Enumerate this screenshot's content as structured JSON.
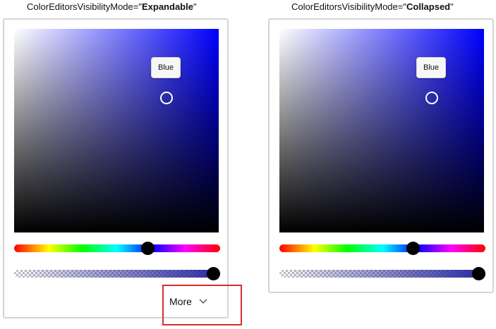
{
  "left_panel": {
    "caption_prefix": "ColorEditorsVisibilityMode=\"",
    "caption_value": "Expandable",
    "caption_suffix": "\"",
    "selected_color_name": "Blue",
    "more_label": "More",
    "hue_level": 0.66,
    "alpha_level": 1.0
  },
  "right_panel": {
    "caption_prefix": "ColorEditorsVisibilityMode=\"",
    "caption_value": "Collapsed",
    "caption_suffix": "\"",
    "selected_color_name": "Blue",
    "hue_level": 0.66,
    "alpha_level": 1.0
  },
  "colors": {
    "accent": "#0000ff",
    "highlight_box": "#d32f2f",
    "panel_border": "#d4d4d4"
  },
  "icons": {
    "more": "chevron-down-icon"
  }
}
